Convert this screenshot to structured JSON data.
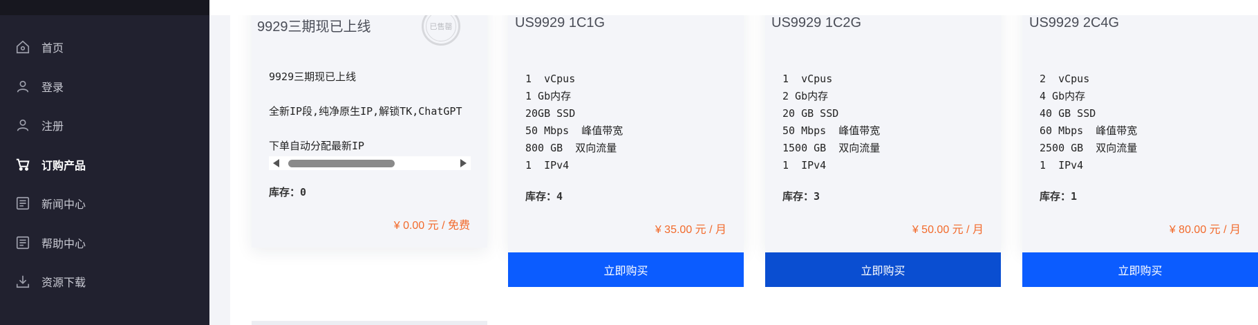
{
  "sidebar": {
    "items": [
      {
        "label": "首页",
        "icon": "home-icon"
      },
      {
        "label": "登录",
        "icon": "user-icon"
      },
      {
        "label": "注册",
        "icon": "user-icon"
      },
      {
        "label": "订购产品",
        "icon": "cart-icon",
        "active": true
      },
      {
        "label": "新闻中心",
        "icon": "document-icon"
      },
      {
        "label": "帮助中心",
        "icon": "document-icon"
      },
      {
        "label": "资源下载",
        "icon": "download-icon"
      }
    ]
  },
  "colors": {
    "sidebar_bg": "#21212f",
    "accent_price": "#f26a2b",
    "buy_button": "#0b5cff",
    "buy_button_hover": "#0a4ed1"
  },
  "first_card": {
    "title": "9929三期现已上线",
    "stamp_text": "已售罄",
    "desc_lines": [
      "9929三期现已上线",
      "全新IP段,纯净原生IP,解锁TK,ChatGPT",
      "下单自动分配最新IP"
    ],
    "stock_label": "库存：",
    "stock_value": "0",
    "price": "¥ 0.00 元 / 免费"
  },
  "products": [
    {
      "title": "US9929 1C1G",
      "specs": [
        "1  vCpus",
        "1 Gb内存",
        "20GB SSD",
        "50 Mbps  峰值带宽",
        "800 GB  双向流量",
        "1  IPv4"
      ],
      "stock_label": "库存：",
      "stock_value": "4",
      "price": "¥ 35.00 元 / 月",
      "button": "立即购买"
    },
    {
      "title": "US9929 1C2G",
      "specs": [
        "1  vCpus",
        "2 Gb内存",
        "20 GB SSD",
        "50 Mbps  峰值带宽",
        "1500 GB  双向流量",
        "1  IPv4"
      ],
      "stock_label": "库存：",
      "stock_value": "3",
      "price": "¥ 50.00 元 / 月",
      "button": "立即购买"
    },
    {
      "title": "US9929 2C4G",
      "specs": [
        "2  vCpus",
        "4 Gb内存",
        "40 GB SSD",
        "60 Mbps  峰值带宽",
        "2500 GB  双向流量",
        "1  IPv4"
      ],
      "stock_label": "库存：",
      "stock_value": "1",
      "price": "¥ 80.00 元 / 月",
      "button": "立即购买"
    }
  ]
}
